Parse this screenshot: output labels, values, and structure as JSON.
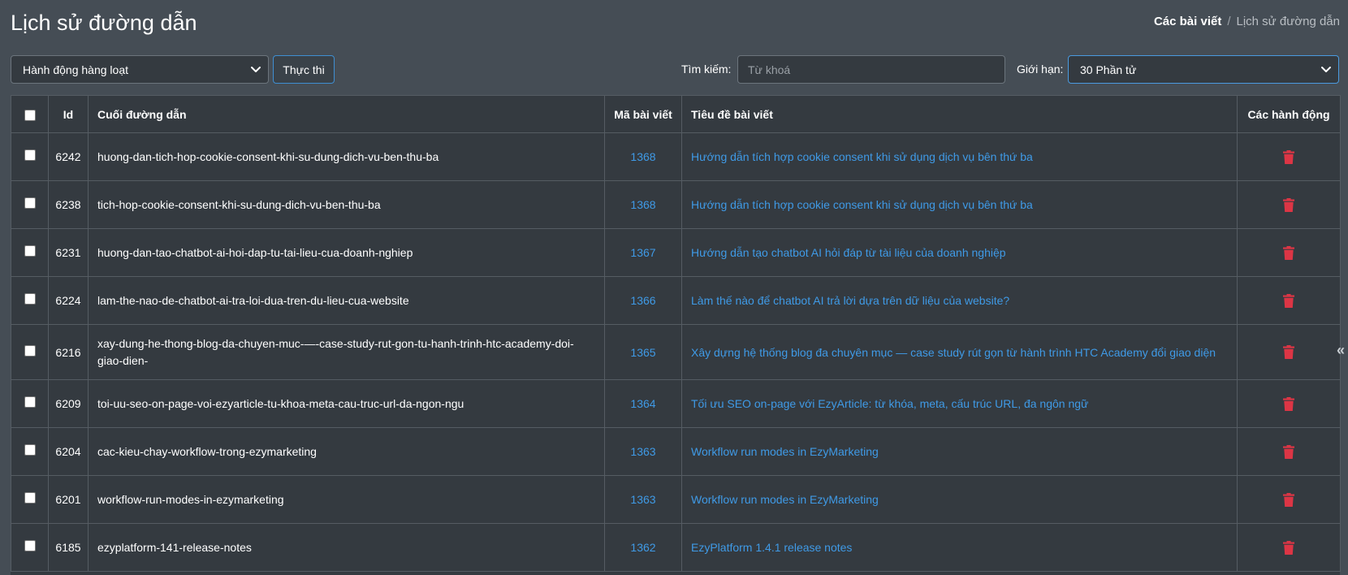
{
  "header": {
    "title": "Lịch sử đường dẫn",
    "breadcrumb": [
      "Các bài viết",
      "Lịch sử đường dẫn"
    ],
    "breadcrumb_sep": "/"
  },
  "toolbar": {
    "bulk_action_selected": "Hành động hàng loạt",
    "execute_label": "Thực thi",
    "search_label": "Tìm kiếm:",
    "search_placeholder": "Từ khoá",
    "limit_label": "Giới hạn:",
    "limit_selected": "30 Phần tử"
  },
  "table": {
    "headers": {
      "id": "Id",
      "slug": "Cuối đường dẫn",
      "post_id": "Mã bài viết",
      "post_title": "Tiêu đề bài viết",
      "actions": "Các hành động"
    },
    "rows": [
      {
        "id": "6242",
        "slug": "huong-dan-tich-hop-cookie-consent-khi-su-dung-dich-vu-ben-thu-ba",
        "post_id": "1368",
        "post_title": "Hướng dẫn tích hợp cookie consent khi sử dụng dịch vụ bên thứ ba"
      },
      {
        "id": "6238",
        "slug": "tich-hop-cookie-consent-khi-su-dung-dich-vu-ben-thu-ba",
        "post_id": "1368",
        "post_title": "Hướng dẫn tích hợp cookie consent khi sử dụng dịch vụ bên thứ ba"
      },
      {
        "id": "6231",
        "slug": "huong-dan-tao-chatbot-ai-hoi-dap-tu-tai-lieu-cua-doanh-nghiep",
        "post_id": "1367",
        "post_title": "Hướng dẫn tạo chatbot AI hỏi đáp từ tài liệu của doanh nghiệp"
      },
      {
        "id": "6224",
        "slug": "lam-the-nao-de-chatbot-ai-tra-loi-dua-tren-du-lieu-cua-website",
        "post_id": "1366",
        "post_title": "Làm thế nào để chatbot AI trả lời dựa trên dữ liệu của website?"
      },
      {
        "id": "6216",
        "slug": "xay-dung-he-thong-blog-da-chuyen-muc-—-case-study-rut-gon-tu-hanh-trinh-htc-academy-doi-giao-dien-",
        "post_id": "1365",
        "post_title": "Xây dựng hệ thống blog đa chuyên mục — case study rút gọn từ hành trình HTC Academy đổi giao diện"
      },
      {
        "id": "6209",
        "slug": "toi-uu-seo-on-page-voi-ezyarticle-tu-khoa-meta-cau-truc-url-da-ngon-ngu",
        "post_id": "1364",
        "post_title": "Tối ưu SEO on-page với EzyArticle: từ khóa, meta, cấu trúc URL, đa ngôn ngữ"
      },
      {
        "id": "6204",
        "slug": "cac-kieu-chay-workflow-trong-ezymarketing",
        "post_id": "1363",
        "post_title": "Workflow run modes in EzyMarketing"
      },
      {
        "id": "6201",
        "slug": "workflow-run-modes-in-ezymarketing",
        "post_id": "1363",
        "post_title": "Workflow run modes in EzyMarketing"
      },
      {
        "id": "6185",
        "slug": "ezyplatform-141-release-notes",
        "post_id": "1362",
        "post_title": "EzyPlatform 1.4.1 release notes"
      }
    ]
  },
  "sidebar_toggle": "«",
  "colors": {
    "background": "#454d55",
    "table_bg": "#343a40",
    "link": "#3f9ae6",
    "danger": "#dc3545"
  },
  "icons": {
    "row_action": "trash-icon",
    "dropdown": "chevron-down-icon"
  }
}
